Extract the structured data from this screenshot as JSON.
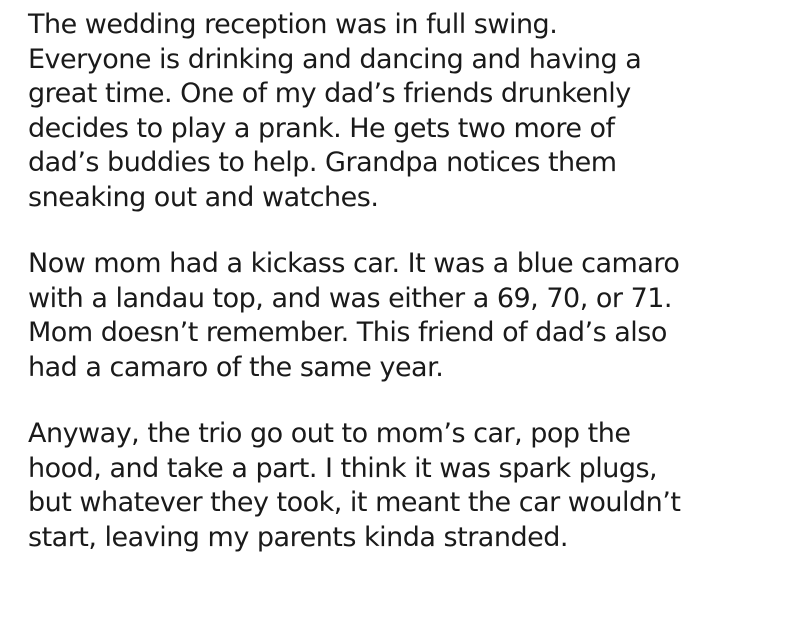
{
  "paragraphs": [
    {
      "lines": [
        "The wedding reception was in full swing.",
        "Everyone is drinking and dancing and having a",
        "great time. One of my dad’s friends drunkenly",
        "decides to play a prank. He gets two more of",
        "dad’s buddies to help. Grandpa notices them",
        "sneaking out and watches."
      ]
    },
    {
      "lines": [
        "Now mom had a kickass car. It was a blue camaro",
        "with a landau top, and was either a 69, 70, or 71.",
        "Mom doesn’t remember. This friend of dad’s also",
        "had a camaro of the same year."
      ]
    },
    {
      "lines": [
        "Anyway, the trio go out to mom’s car, pop the",
        "hood, and take a part. I think it was spark plugs,",
        "but whatever they took, it meant the car wouldn’t",
        "start, leaving my parents kinda stranded."
      ]
    }
  ]
}
